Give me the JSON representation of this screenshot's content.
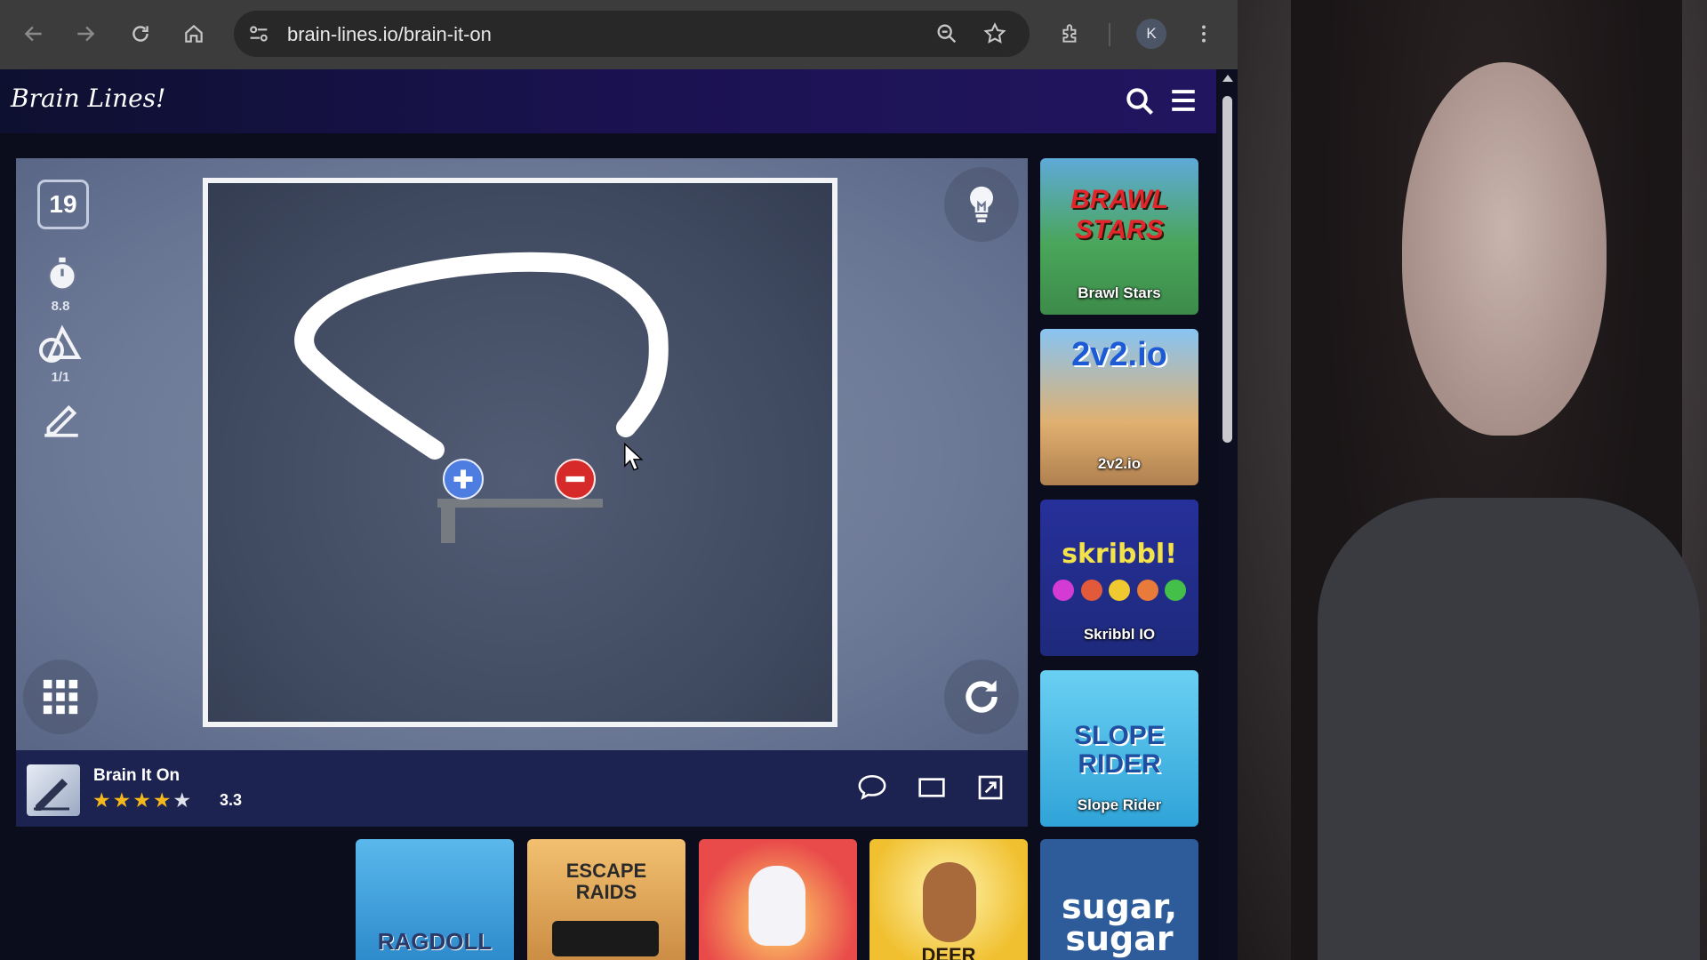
{
  "browser": {
    "url": "brain-lines.io/brain-it-on",
    "profile_initial": "K"
  },
  "site": {
    "logo": "Brain Lines!"
  },
  "game": {
    "level": "19",
    "timer": "8.8",
    "shapes": "1/1",
    "title": "Brain It On",
    "rating": "3.3",
    "stars_filled": 4,
    "stars_total": 5
  },
  "side_ads": [
    {
      "big": "BRAWL STARS",
      "label": "Brawl Stars",
      "color": "#d5242a"
    },
    {
      "big": "2v2.io",
      "label": "2v2.io",
      "color": "#2d7fd6"
    },
    {
      "big": "skribbl!",
      "label": "Skribbl IO",
      "color": "#2a3aa8"
    },
    {
      "big": "SLOPE RIDER",
      "label": "Slope Rider",
      "color": "#3ab8e8"
    }
  ],
  "bottom_ads": [
    {
      "big": "RAGDOLL",
      "color": "#3aa0e0"
    },
    {
      "big": "ESCAPE RAIDS",
      "color": "#e8a040"
    },
    {
      "big": "",
      "color": "#e94a4a"
    },
    {
      "big": "DEER",
      "color": "#f0c030"
    },
    {
      "big": "sugar, sugar",
      "color": "#3068a8"
    }
  ]
}
